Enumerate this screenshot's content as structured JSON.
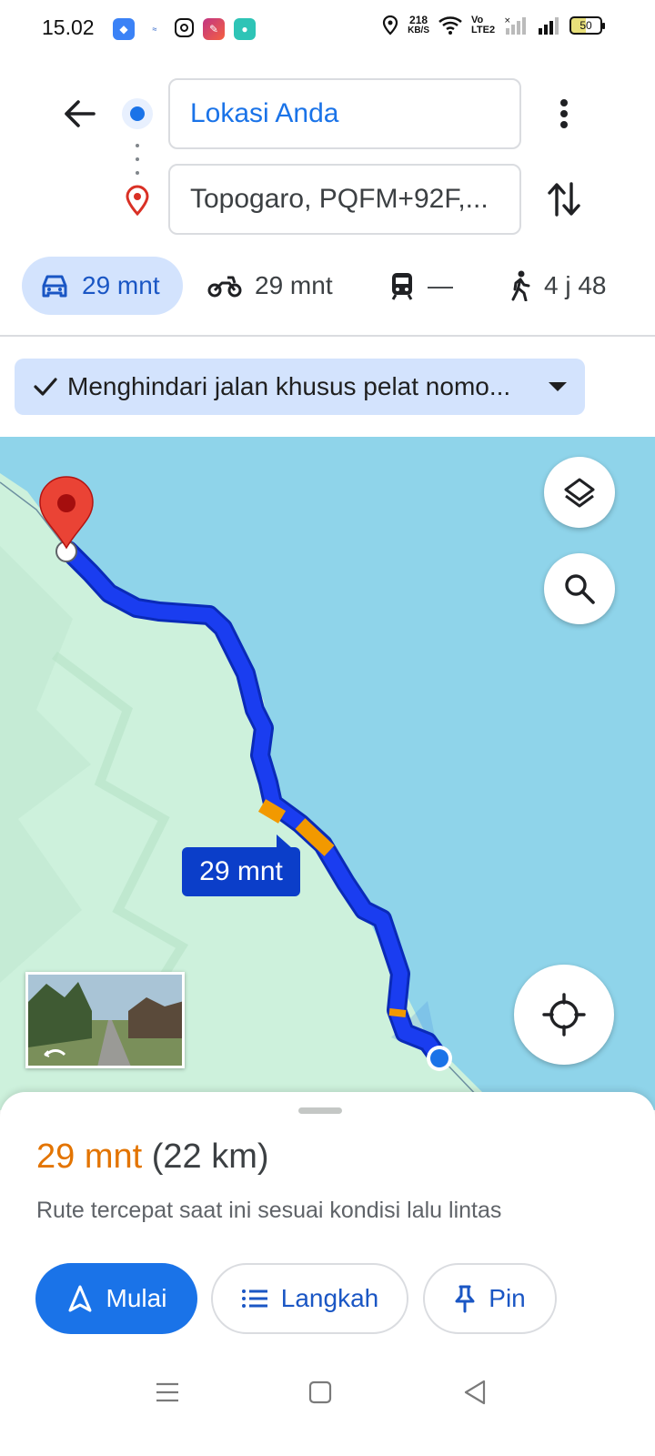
{
  "status_bar": {
    "time": "15.02",
    "speed_value": "218",
    "speed_unit": "KB/S",
    "volte_label": "Vo LTE2",
    "battery": "50"
  },
  "directions": {
    "origin_text": "Lokasi Anda",
    "destination_text": "Topogaro, PQFM+92F,..."
  },
  "modes": [
    {
      "icon": "car-icon",
      "label": "29 mnt"
    },
    {
      "icon": "motorcycle-icon",
      "label": "29 mnt"
    },
    {
      "icon": "transit-icon",
      "label": "—"
    },
    {
      "icon": "walk-icon",
      "label": "4 j 48"
    }
  ],
  "avoid_chip": {
    "label": "Menghindari jalan khusus pelat nomo..."
  },
  "map": {
    "route_time_label": "29 mnt",
    "route_color": "#1a3df0",
    "traffic_color": "#f29900",
    "land_color": "#cdf1dc",
    "water_color": "#8fd4ea"
  },
  "sheet": {
    "time": "29 mnt",
    "distance": "(22 km)",
    "description": "Rute tercepat saat ini sesuai kondisi lalu lintas",
    "start_label": "Mulai",
    "steps_label": "Langkah",
    "pin_label": "Pin"
  }
}
